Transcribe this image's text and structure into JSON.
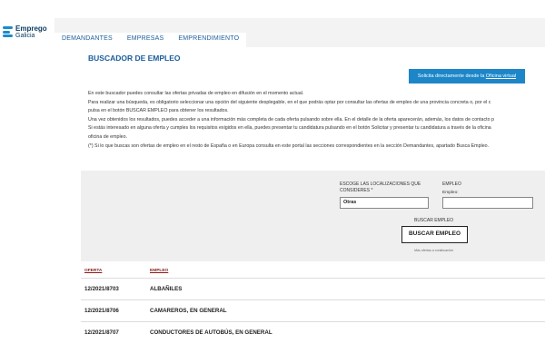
{
  "logo": {
    "line1": "Emprego",
    "line2": "Galicia"
  },
  "tabs": [
    {
      "label": "DEMANDANTES"
    },
    {
      "label": "EMPRESAS"
    },
    {
      "label": "EMPRENDIMIENTO"
    }
  ],
  "page": {
    "title": "BUSCADOR DE EMPLEO",
    "virtual_button_text": "Solicita directamente desde la ",
    "virtual_button_link": "Oficina virtual"
  },
  "intro": [
    "En este buscador puedes consultar las ofertas privadas de empleo en difusión en el momento actual.",
    "Para realizar una búsqueda, es obligatorio seleccionar una opción del siguiente desplegable, en el que podrás optar por consultar las ofertas de empleo de una provincia concreta o, por el c",
    "pulsa en el botón BUSCAR EMPLEO para obtener los resultados.",
    "Una vez obtenidos los resultados, puedes acceder a una información más completa de cada oferta pulsando sobre ella. En el detalle de la oferta aparecerán, además, los datos de contacto p",
    "Si estás interesado en alguna oferta y cumples los requisitos exigidos en ella, puedes presentar tu candidatura pulsando en el botón Solicitar y presentar tu candidatura a través de la oficina",
    "oficina de empleo.",
    "(*) Si lo que buscas son ofertas de empleo en el resto de España o en Europa consulta en este portal las secciones correspondientes en la sección Demandantes, apartado Busca Empleo."
  ],
  "search": {
    "location_label": "ESCOGE LAS LOCALIZACIONES QUE CONSIDERES *",
    "location_value": "Otras",
    "empleo_label": "EMPLEO",
    "empleo_sublabel": "Empleo:",
    "empleo_value": "",
    "buscar_label": "BUSCAR EMPLEO",
    "buscar_button": "BUSCAR EMPLEO",
    "sort_note": "Más ofertas a continuación"
  },
  "results": {
    "headers": {
      "oferta": "OFERTA",
      "empleo": "EMPLEO"
    },
    "rows": [
      {
        "oferta": "12/2021/8703",
        "empleo": "ALBAÑILES"
      },
      {
        "oferta": "12/2021/8706",
        "empleo": "CAMAREROS, EN GENERAL"
      },
      {
        "oferta": "12/2021/8707",
        "empleo": "CONDUCTORES DE AUTOBÚS, EN GENERAL"
      }
    ]
  },
  "colors": {
    "brand_blue": "#1c86c8",
    "title_blue": "#1a5d9c",
    "header_red": "#8b1a1a"
  }
}
